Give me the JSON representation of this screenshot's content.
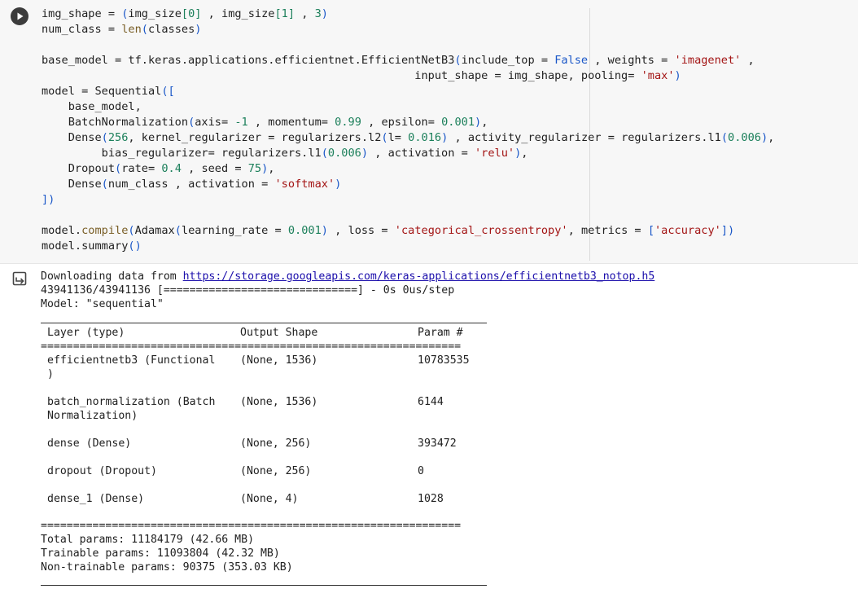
{
  "cell": {
    "code_lines": [
      [
        [
          "img_shape = ",
          "p"
        ],
        [
          "(",
          "br"
        ],
        [
          "img_size",
          "p"
        ],
        [
          "[",
          "n"
        ],
        [
          "0",
          "n"
        ],
        [
          "]",
          "n"
        ],
        [
          " , img_size",
          "p"
        ],
        [
          "[",
          "n"
        ],
        [
          "1",
          "n"
        ],
        [
          "]",
          "n"
        ],
        [
          " , ",
          "p"
        ],
        [
          "3",
          "n"
        ],
        [
          ")",
          "br"
        ]
      ],
      [
        [
          "num_class = ",
          "p"
        ],
        [
          "len",
          "f"
        ],
        [
          "(",
          "br"
        ],
        [
          "classes",
          "p"
        ],
        [
          ")",
          "br"
        ]
      ],
      [
        [
          "",
          "p"
        ]
      ],
      [
        [
          "base_model = tf.keras.applications.efficientnet.EfficientNetB3",
          "p"
        ],
        [
          "(",
          "br"
        ],
        [
          "include_top = ",
          "p"
        ],
        [
          "False",
          "b"
        ],
        [
          " , weights = ",
          "p"
        ],
        [
          "'imagenet'",
          "s"
        ],
        [
          " ,",
          "p"
        ]
      ],
      [
        [
          "                                                        input_shape = img_shape, pooling= ",
          "p"
        ],
        [
          "'max'",
          "s"
        ],
        [
          ")",
          "br"
        ]
      ],
      [
        [
          "model = Sequential",
          "p"
        ],
        [
          "([",
          "br"
        ]
      ],
      [
        [
          "    base_model,",
          "p"
        ]
      ],
      [
        [
          "    BatchNormalization",
          "p"
        ],
        [
          "(",
          "br"
        ],
        [
          "axis= ",
          "p"
        ],
        [
          "-1",
          "n"
        ],
        [
          " , momentum= ",
          "p"
        ],
        [
          "0.99",
          "n"
        ],
        [
          " , epsilon= ",
          "p"
        ],
        [
          "0.001",
          "n"
        ],
        [
          ")",
          "br"
        ],
        [
          ",",
          "p"
        ]
      ],
      [
        [
          "    Dense",
          "p"
        ],
        [
          "(",
          "br"
        ],
        [
          "256",
          "n"
        ],
        [
          ", kernel_regularizer = regularizers.l2",
          "p"
        ],
        [
          "(",
          "br"
        ],
        [
          "l= ",
          "p"
        ],
        [
          "0.016",
          "n"
        ],
        [
          ")",
          "br"
        ],
        [
          " , activity_regularizer = regularizers.l1",
          "p"
        ],
        [
          "(",
          "br"
        ],
        [
          "0.006",
          "n"
        ],
        [
          ")",
          "br"
        ],
        [
          ",",
          "p"
        ]
      ],
      [
        [
          "         bias_regularizer= regularizers.l1",
          "p"
        ],
        [
          "(",
          "br"
        ],
        [
          "0.006",
          "n"
        ],
        [
          ")",
          "br"
        ],
        [
          " , activation = ",
          "p"
        ],
        [
          "'relu'",
          "s"
        ],
        [
          ")",
          "br"
        ],
        [
          ",",
          "p"
        ]
      ],
      [
        [
          "    Dropout",
          "p"
        ],
        [
          "(",
          "br"
        ],
        [
          "rate= ",
          "p"
        ],
        [
          "0.4",
          "n"
        ],
        [
          " , seed = ",
          "p"
        ],
        [
          "75",
          "n"
        ],
        [
          ")",
          "br"
        ],
        [
          ",",
          "p"
        ]
      ],
      [
        [
          "    Dense",
          "p"
        ],
        [
          "(",
          "br"
        ],
        [
          "num_class , activation = ",
          "p"
        ],
        [
          "'softmax'",
          "s"
        ],
        [
          ")",
          "br"
        ]
      ],
      [
        [
          "])",
          "br"
        ]
      ],
      [
        [
          "",
          "p"
        ]
      ],
      [
        [
          "model.",
          "p"
        ],
        [
          "compile",
          "f"
        ],
        [
          "(",
          "br"
        ],
        [
          "Adamax",
          "p"
        ],
        [
          "(",
          "br"
        ],
        [
          "learning_rate = ",
          "p"
        ],
        [
          "0.001",
          "n"
        ],
        [
          ")",
          "br"
        ],
        [
          " , loss = ",
          "p"
        ],
        [
          "'categorical_crossentropy'",
          "s"
        ],
        [
          ", metrics = ",
          "p"
        ],
        [
          "[",
          "br"
        ],
        [
          "'accuracy'",
          "s"
        ],
        [
          "])",
          "br"
        ]
      ],
      [
        [
          "model.summary",
          "p"
        ],
        [
          "()",
          "br"
        ]
      ]
    ]
  },
  "output": {
    "download_prefix": "Downloading data from ",
    "download_url": "https://storage.googleapis.com/keras-applications/efficientnetb3_notop.h5",
    "progress_line": "43941136/43941136 [==============================] - 0s 0us/step",
    "model_line": "Model: \"sequential\"",
    "header": {
      "layer": "Layer (type)",
      "shape": "Output Shape",
      "params": "Param #"
    },
    "double_rule": "=================================================================",
    "rows": [
      {
        "layer": [
          "efficientnetb3 (Functional",
          ")"
        ],
        "shape": "(None, 1536)",
        "params": "10783535"
      },
      {
        "layer": [
          "batch_normalization (Batch",
          "Normalization)"
        ],
        "shape": "(None, 1536)",
        "params": "6144"
      },
      {
        "layer": [
          "dense (Dense)"
        ],
        "shape": "(None, 256)",
        "params": "393472"
      },
      {
        "layer": [
          "dropout (Dropout)"
        ],
        "shape": "(None, 256)",
        "params": "0"
      },
      {
        "layer": [
          "dense_1 (Dense)"
        ],
        "shape": "(None, 4)",
        "params": "1028"
      }
    ],
    "totals": [
      "Total params: 11184179 (42.66 MB)",
      "Trainable params: 11093804 (42.32 MB)",
      "Non-trainable params: 90375 (353.03 KB)"
    ]
  },
  "icons": {
    "run": "play-icon",
    "output": "output-redirect-icon"
  }
}
